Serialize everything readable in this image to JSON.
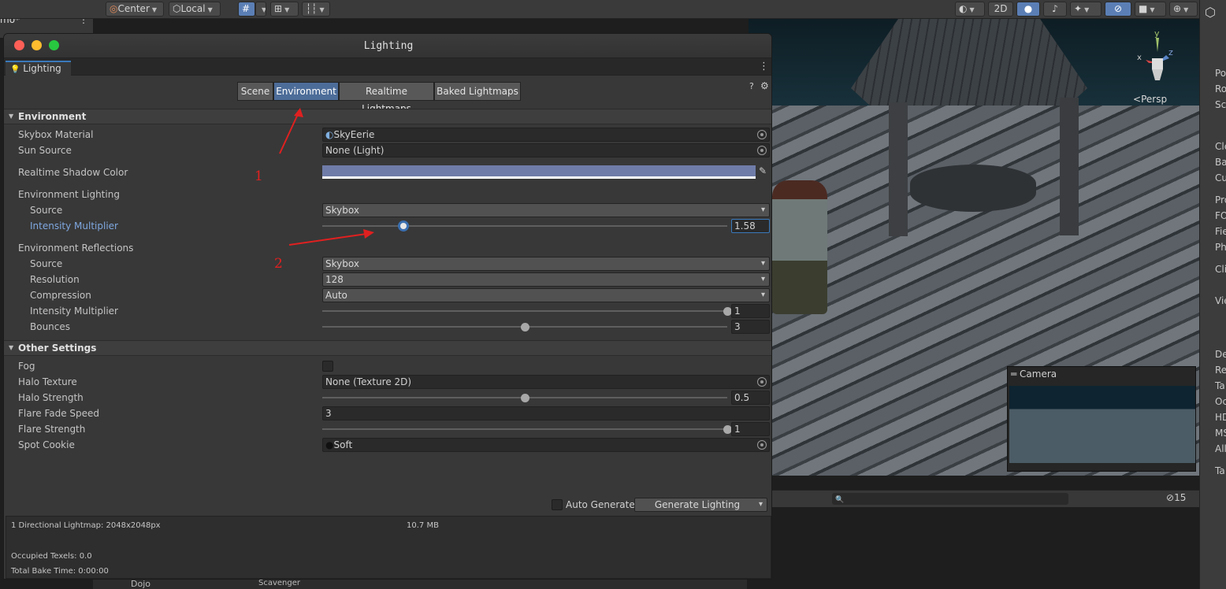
{
  "toolbar": {
    "center_label": "Center",
    "local_label": "Local",
    "mode_2d_label": "2D"
  },
  "hierarchy": {
    "scene_tab": "mo*",
    "bottom_item": "Dojo",
    "bottom_item2": "Scavenger"
  },
  "scene_view": {
    "persp_label": "Persp",
    "camera_preview_title": "Camera",
    "visible_count": "15"
  },
  "inspector": {
    "labels": [
      "Po",
      "Ro",
      "Sc",
      "Cle",
      "Ba",
      "Cu",
      "Pro",
      "FO",
      "Fie",
      "Ph",
      "Cli",
      "Vie",
      "De",
      "Re",
      "Ta",
      "Oc",
      "HD",
      "MS",
      "All",
      "Ta"
    ]
  },
  "lighting": {
    "window_title": "Lighting",
    "tab_label": "Lighting",
    "segments": [
      "Scene",
      "Environment",
      "Realtime Lightmaps",
      "Baked Lightmaps"
    ],
    "active_segment": "Environment",
    "environment": {
      "header": "Environment",
      "skybox_material_label": "Skybox Material",
      "skybox_material_value": "SkyEerie",
      "sun_source_label": "Sun Source",
      "sun_source_value": "None (Light)",
      "shadow_color_label": "Realtime Shadow Color",
      "shadow_color_value": "#6f7ca8",
      "env_lighting_label": "Environment Lighting",
      "source_label": "Source",
      "source_value": "Skybox",
      "intensity_label": "Intensity Multiplier",
      "intensity_value": "1.58",
      "intensity_fraction": 0.2,
      "env_reflections_label": "Environment Reflections",
      "refl_source_label": "Source",
      "refl_source_value": "Skybox",
      "resolution_label": "Resolution",
      "resolution_value": "128",
      "compression_label": "Compression",
      "compression_value": "Auto",
      "refl_intensity_label": "Intensity Multiplier",
      "refl_intensity_value": "1",
      "refl_intensity_fraction": 1.0,
      "bounces_label": "Bounces",
      "bounces_value": "3",
      "bounces_fraction": 0.5
    },
    "other": {
      "header": "Other Settings",
      "fog_label": "Fog",
      "fog_checked": false,
      "halo_texture_label": "Halo Texture",
      "halo_texture_value": "None (Texture 2D)",
      "halo_strength_label": "Halo Strength",
      "halo_strength_value": "0.5",
      "halo_strength_fraction": 0.5,
      "flare_fade_label": "Flare Fade Speed",
      "flare_fade_value": "3",
      "flare_strength_label": "Flare Strength",
      "flare_strength_value": "1",
      "flare_strength_fraction": 1.0,
      "spot_cookie_label": "Spot Cookie",
      "spot_cookie_value": "Soft"
    },
    "auto_generate_label": "Auto Generate",
    "auto_generate_checked": false,
    "generate_button_label": "Generate Lighting",
    "footer": {
      "lightmap_info": "1 Directional Lightmap: 2048x2048px",
      "lightmap_size": "10.7 MB",
      "occupied_texels": "Occupied Texels: 0.0",
      "bake_time": "Total Bake Time: 0:00:00"
    }
  },
  "annotations": {
    "marker_1": "1",
    "marker_2": "2"
  },
  "colors": {
    "accent_blue": "#3a79bb",
    "annotation_red": "#e02020"
  }
}
